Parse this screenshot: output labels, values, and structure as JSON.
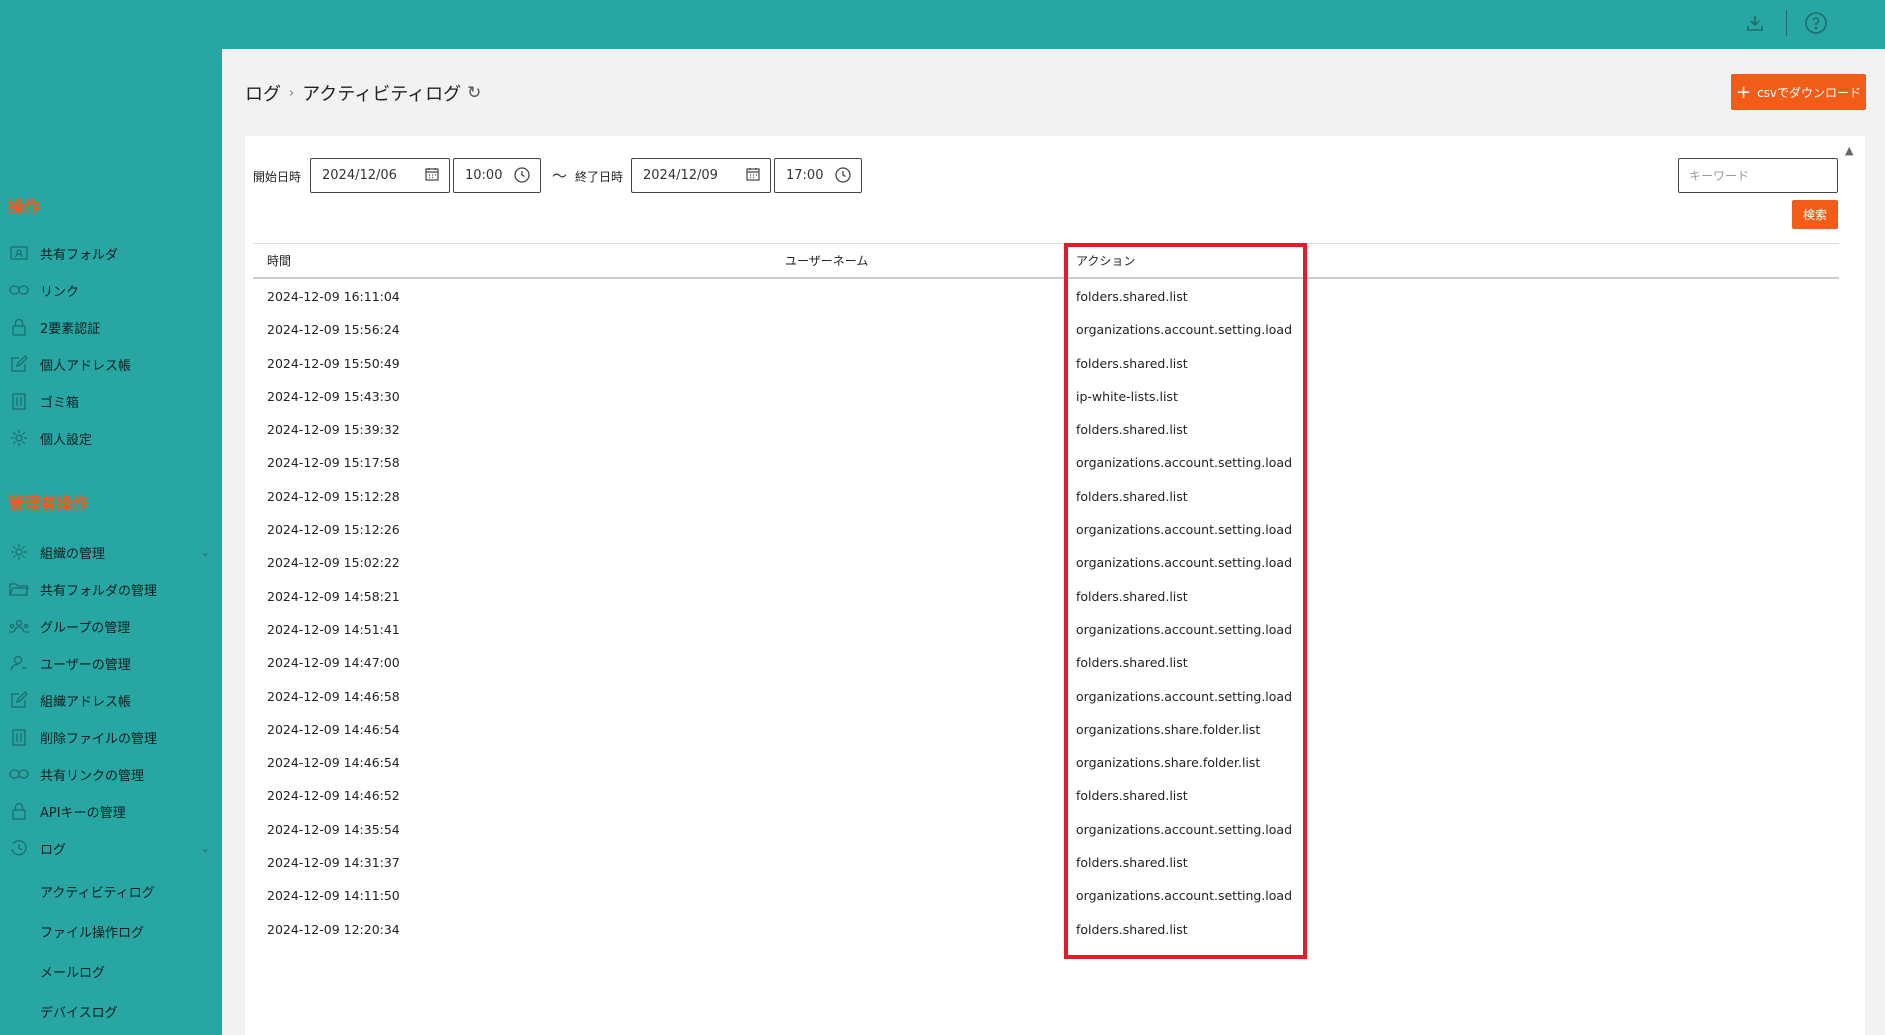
{
  "header": {
    "download_icon": "download-icon",
    "help_icon": "help-circle-icon"
  },
  "sidebar": {
    "section_ops": "操作",
    "ops_items": [
      {
        "label": "共有フォルダ",
        "icon": "shared-folder-icon"
      },
      {
        "label": "リンク",
        "icon": "link-icon"
      },
      {
        "label": "2要素認証",
        "icon": "lock-icon"
      },
      {
        "label": "個人アドレス帳",
        "icon": "edit-icon"
      },
      {
        "label": "ゴミ箱",
        "icon": "trash-icon"
      },
      {
        "label": "個人設定",
        "icon": "gear-icon"
      }
    ],
    "section_admin": "管理者操作",
    "admin_items": [
      {
        "label": "組織の管理",
        "icon": "gear-icon"
      },
      {
        "label": "共有フォルダの管理",
        "icon": "folder-open-icon"
      },
      {
        "label": "グループの管理",
        "icon": "group-icon"
      },
      {
        "label": "ユーザーの管理",
        "icon": "user-icon"
      },
      {
        "label": "組織アドレス帳",
        "icon": "edit-icon"
      },
      {
        "label": "削除ファイルの管理",
        "icon": "trash-icon"
      },
      {
        "label": "共有リンクの管理",
        "icon": "link-icon"
      },
      {
        "label": "APIキーの管理",
        "icon": "lock-icon"
      },
      {
        "label": "ログ",
        "icon": "history-icon"
      }
    ],
    "log_sub_items": [
      "アクティビティログ",
      "ファイル操作ログ",
      "メールログ",
      "デバイスログ"
    ]
  },
  "breadcrumb": {
    "root": "ログ",
    "current": "アクティビティログ"
  },
  "csv_button": "csvでダウンロード",
  "filters": {
    "start_label": "開始日時",
    "start_date": "2024/12/06",
    "start_time": "10:00",
    "tilde": "〜",
    "end_label": "終了日時",
    "end_date": "2024/12/09",
    "end_time": "17:00",
    "keyword_placeholder": "キーワード",
    "search_label": "検索"
  },
  "table": {
    "columns": [
      "時間",
      "ユーザーネーム",
      "アクション"
    ],
    "rows": [
      {
        "time": "2024-12-09 16:11:04",
        "user": "",
        "action": "folders.shared.list"
      },
      {
        "time": "2024-12-09 15:56:24",
        "user": "",
        "action": "organizations.account.setting.load"
      },
      {
        "time": "2024-12-09 15:50:49",
        "user": "",
        "action": "folders.shared.list"
      },
      {
        "time": "2024-12-09 15:43:30",
        "user": "",
        "action": "ip-white-lists.list"
      },
      {
        "time": "2024-12-09 15:39:32",
        "user": "",
        "action": "folders.shared.list"
      },
      {
        "time": "2024-12-09 15:17:58",
        "user": "",
        "action": "organizations.account.setting.load"
      },
      {
        "time": "2024-12-09 15:12:28",
        "user": "",
        "action": "folders.shared.list"
      },
      {
        "time": "2024-12-09 15:12:26",
        "user": "",
        "action": "organizations.account.setting.load"
      },
      {
        "time": "2024-12-09 15:02:22",
        "user": "",
        "action": "organizations.account.setting.load"
      },
      {
        "time": "2024-12-09 14:58:21",
        "user": "",
        "action": "folders.shared.list"
      },
      {
        "time": "2024-12-09 14:51:41",
        "user": "",
        "action": "organizations.account.setting.load"
      },
      {
        "time": "2024-12-09 14:47:00",
        "user": "",
        "action": "folders.shared.list"
      },
      {
        "time": "2024-12-09 14:46:58",
        "user": "",
        "action": "organizations.account.setting.load"
      },
      {
        "time": "2024-12-09 14:46:54",
        "user": "",
        "action": "organizations.share.folder.list"
      },
      {
        "time": "2024-12-09 14:46:54",
        "user": "",
        "action": "organizations.share.folder.list"
      },
      {
        "time": "2024-12-09 14:46:52",
        "user": "",
        "action": "folders.shared.list"
      },
      {
        "time": "2024-12-09 14:35:54",
        "user": "",
        "action": "organizations.account.setting.load"
      },
      {
        "time": "2024-12-09 14:31:37",
        "user": "",
        "action": "folders.shared.list"
      },
      {
        "time": "2024-12-09 14:11:50",
        "user": "",
        "action": "organizations.account.setting.load"
      },
      {
        "time": "2024-12-09 12:20:34",
        "user": "",
        "action": "folders.shared.list"
      }
    ]
  },
  "colors": {
    "teal": "#27a6a3",
    "accent_orange": "#f25c19",
    "highlight_red": "#e11d2a"
  }
}
